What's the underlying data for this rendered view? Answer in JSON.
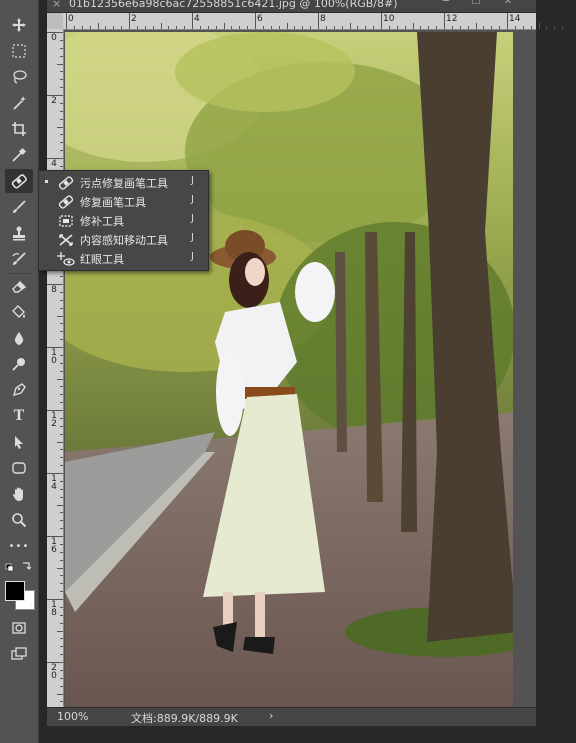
{
  "document": {
    "tab_close": "×",
    "title": "01b12356e6a98c6ac72558851c6421.jpg @ 100%(RGB/8#)",
    "window_min": "─",
    "window_max": "☐",
    "window_close": "✕"
  },
  "ruler": {
    "h_labels": [
      "0",
      "2",
      "4",
      "6",
      "8",
      "10",
      "12",
      "14"
    ],
    "v_labels": [
      "0",
      "2",
      "4",
      "6",
      "8",
      "10",
      "12",
      "14",
      "16",
      "18",
      "20"
    ]
  },
  "toolbar": {
    "tools": [
      {
        "name": "move-tool-icon"
      },
      {
        "name": "marquee-tool-icon"
      },
      {
        "name": "lasso-tool-icon"
      },
      {
        "name": "magic-wand-tool-icon"
      },
      {
        "name": "crop-tool-icon"
      },
      {
        "name": "eyedropper-tool-icon"
      },
      {
        "name": "healing-brush-tool-icon",
        "active": true
      },
      {
        "name": "brush-tool-icon"
      },
      {
        "name": "clone-stamp-tool-icon"
      },
      {
        "name": "history-brush-tool-icon"
      },
      {
        "name": "eraser-tool-icon"
      },
      {
        "name": "paint-bucket-tool-icon"
      },
      {
        "name": "blur-tool-icon"
      },
      {
        "name": "dodge-tool-icon"
      },
      {
        "name": "pen-tool-icon"
      },
      {
        "name": "type-tool-icon",
        "glyph": "T"
      },
      {
        "name": "path-selection-tool-icon"
      },
      {
        "name": "rectangle-tool-icon"
      },
      {
        "name": "hand-tool-icon"
      },
      {
        "name": "zoom-tool-icon"
      },
      {
        "name": "more-tools-icon",
        "glyph": "•••"
      },
      {
        "name": "color-swatches-icon"
      },
      {
        "name": "quick-mask-icon"
      },
      {
        "name": "screen-mode-icon"
      }
    ],
    "foreground_color": "#000000",
    "background_color": "#ffffff"
  },
  "flyout": {
    "items": [
      {
        "label": "污点修复画笔工具",
        "shortcut": "J",
        "selected": true,
        "icon": "spot-healing-brush-icon"
      },
      {
        "label": "修复画笔工具",
        "shortcut": "J",
        "selected": false,
        "icon": "healing-brush-icon"
      },
      {
        "label": "修补工具",
        "shortcut": "J",
        "selected": false,
        "icon": "patch-tool-icon"
      },
      {
        "label": "内容感知移动工具",
        "shortcut": "J",
        "selected": false,
        "icon": "content-aware-move-icon"
      },
      {
        "label": "红眼工具",
        "shortcut": "J",
        "selected": false,
        "icon": "red-eye-tool-icon"
      }
    ]
  },
  "status": {
    "zoom": "100%",
    "doc_info": "文档:889.9K/889.9K",
    "arrow": "›"
  },
  "colors": {
    "toolbar_bg": "#535353",
    "menu_bg": "#474747",
    "app_bg": "#282828"
  }
}
